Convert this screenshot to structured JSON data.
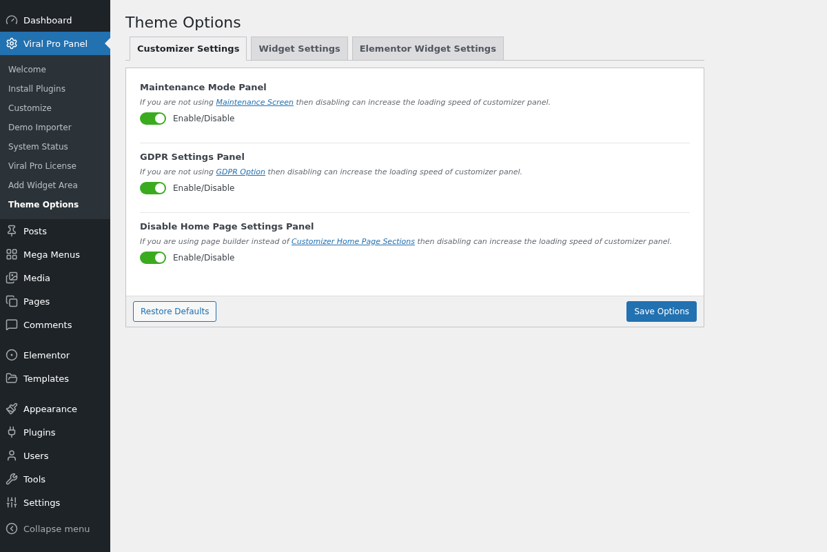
{
  "sidebar": {
    "groups": [
      [
        {
          "label": "Dashboard",
          "selected": false
        },
        {
          "label": "Viral Pro Panel",
          "selected": true,
          "submenu": [
            {
              "label": "Welcome",
              "selected": false
            },
            {
              "label": "Install Plugins",
              "selected": false
            },
            {
              "label": "Customize",
              "selected": false
            },
            {
              "label": "Demo Importer",
              "selected": false
            },
            {
              "label": "System Status",
              "selected": false
            },
            {
              "label": "Viral Pro License",
              "selected": false
            },
            {
              "label": "Add Widget Area",
              "selected": false
            },
            {
              "label": "Theme Options",
              "selected": true
            }
          ]
        },
        {
          "label": "Posts",
          "selected": false
        },
        {
          "label": "Mega Menus",
          "selected": false
        },
        {
          "label": "Media",
          "selected": false
        },
        {
          "label": "Pages",
          "selected": false
        },
        {
          "label": "Comments",
          "selected": false
        }
      ],
      [
        {
          "label": "Elementor",
          "selected": false
        },
        {
          "label": "Templates",
          "selected": false
        }
      ],
      [
        {
          "label": "Appearance",
          "selected": false
        },
        {
          "label": "Plugins",
          "selected": false
        },
        {
          "label": "Users",
          "selected": false
        },
        {
          "label": "Tools",
          "selected": false
        },
        {
          "label": "Settings",
          "selected": false
        }
      ]
    ],
    "collapse": "Collapse menu"
  },
  "page": {
    "title": "Theme Options",
    "tabs": [
      {
        "label": "Customizer Settings",
        "selected": true
      },
      {
        "label": "Widget Settings",
        "selected": false
      },
      {
        "label": "Elementor Widget Settings",
        "selected": false
      }
    ],
    "options": [
      {
        "title": "Maintenance Mode Panel",
        "description": {
          "before": "If you are not using ",
          "link": "Maintenance Screen",
          "after": " then disabling can increase the loading speed of customizer panel."
        },
        "toggle_label": "Enable/Disable",
        "on": true
      },
      {
        "title": "GDPR Settings Panel",
        "description": {
          "before": "If you are not using ",
          "link": "GDPR Option",
          "after": " then disabling can increase the loading speed of customizer panel."
        },
        "toggle_label": "Enable/Disable",
        "on": true
      },
      {
        "title": "Disable Home Page Settings Panel",
        "description": {
          "before": "If you are using page builder instead of ",
          "link": "Customizer Home Page Sections",
          "after": " then disabling can increase the loading speed of customizer panel."
        },
        "toggle_label": "Enable/Disable",
        "on": true
      }
    ],
    "buttons": {
      "restore": "Restore Defaults",
      "save": "Save Options"
    }
  }
}
